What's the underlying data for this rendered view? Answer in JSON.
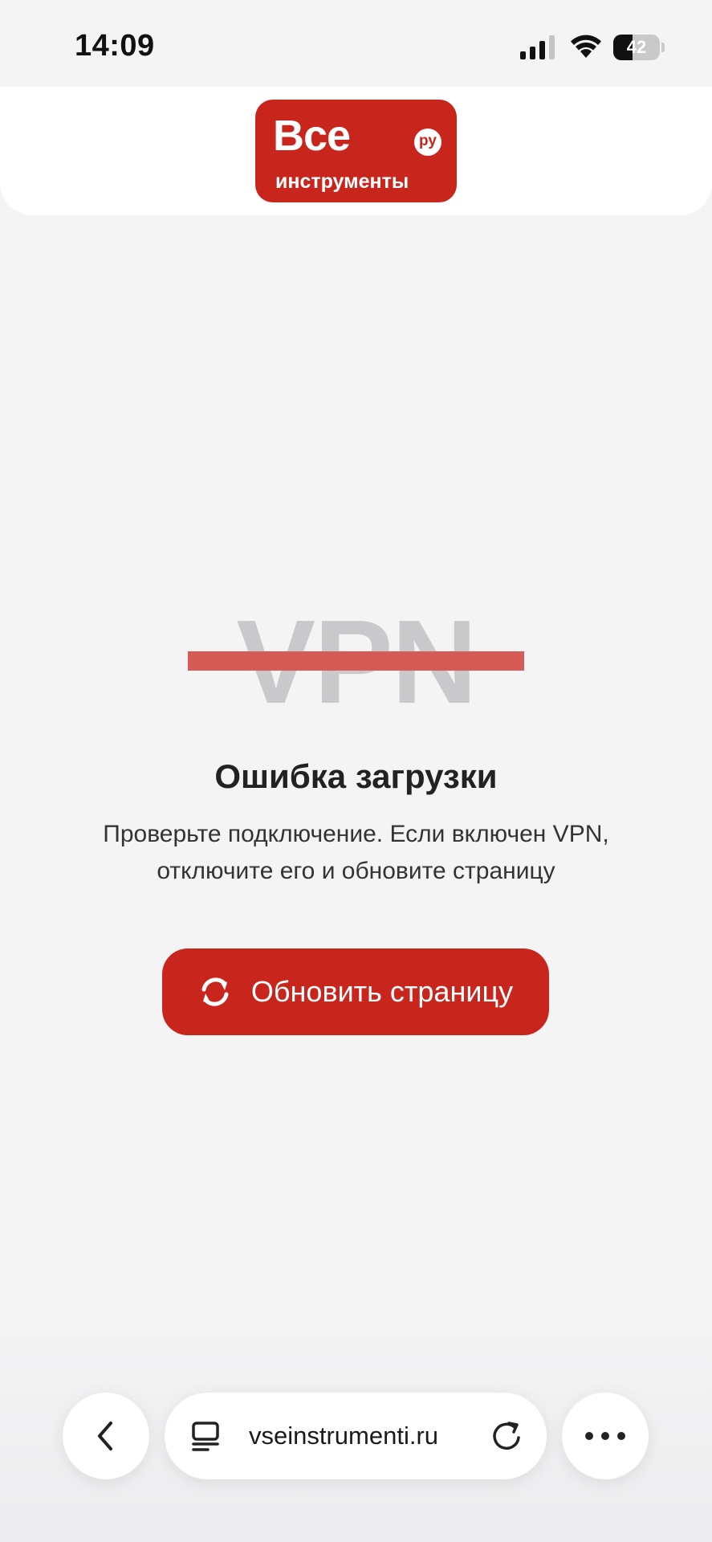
{
  "status_bar": {
    "time": "14:09",
    "battery_level": "42",
    "icons": [
      "signal-icon",
      "wifi-icon",
      "battery-icon"
    ]
  },
  "header": {
    "logo": {
      "line1": "Все",
      "line2": "инструменты",
      "badge": "ру"
    }
  },
  "error": {
    "graphic_text": "VPN",
    "title": "Ошибка загрузки",
    "message_line1": "Проверьте подключение. Если включен VPN,",
    "message_line2": "отключите его и обновите страницу",
    "button_label": "Обновить страницу",
    "button_icon": "refresh-icon"
  },
  "browser_bar": {
    "url": "vseinstrumenti.ru",
    "icons": [
      "back-icon",
      "reader-icon",
      "reload-icon",
      "more-icon"
    ]
  },
  "colors": {
    "brand_red": "#c8261d",
    "strike_red": "#d65a55",
    "background": "#f4f4f5"
  }
}
